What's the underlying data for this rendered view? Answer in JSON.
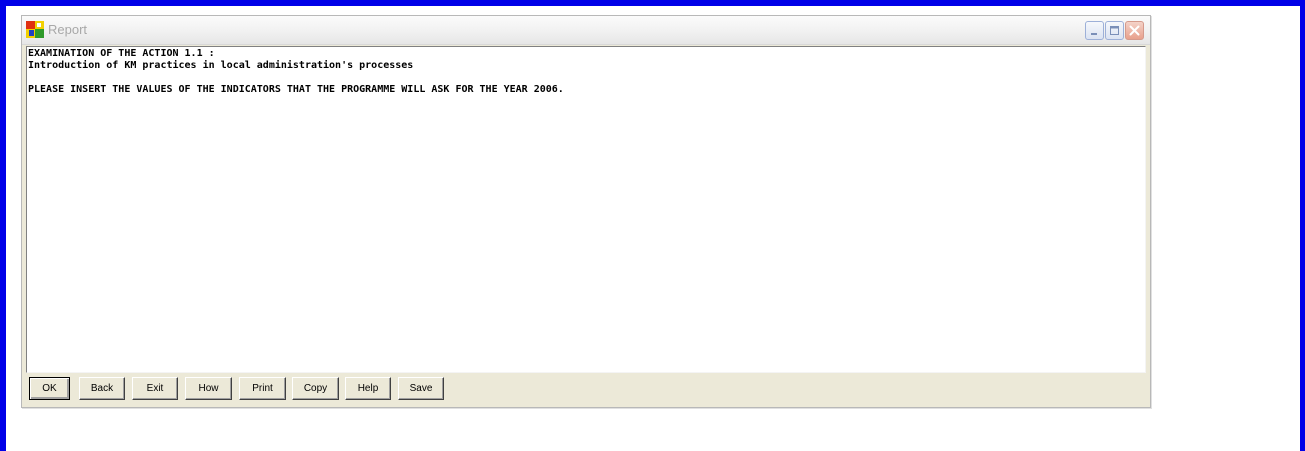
{
  "window": {
    "title": "Report",
    "controls": {
      "minimize_icon": "minimize-icon",
      "maximize_icon": "maximize-icon",
      "close_icon": "close-icon"
    }
  },
  "report": {
    "lines": [
      "EXAMINATION OF THE ACTION 1.1 :",
      "Introduction of KM practices in local administration's processes",
      "",
      "PLEASE INSERT THE VALUES OF THE INDICATORS THAT THE PROGRAMME WILL ASK FOR THE YEAR 2006."
    ]
  },
  "buttons": {
    "ok": "OK",
    "back": "Back",
    "exit": "Exit",
    "how": "How",
    "print": "Print",
    "copy": "Copy",
    "help": "Help",
    "save": "Save"
  },
  "colors": {
    "desktop_border": "#0000e8",
    "dialog_face": "#ece9d8",
    "title_text": "#a8a8a8"
  }
}
